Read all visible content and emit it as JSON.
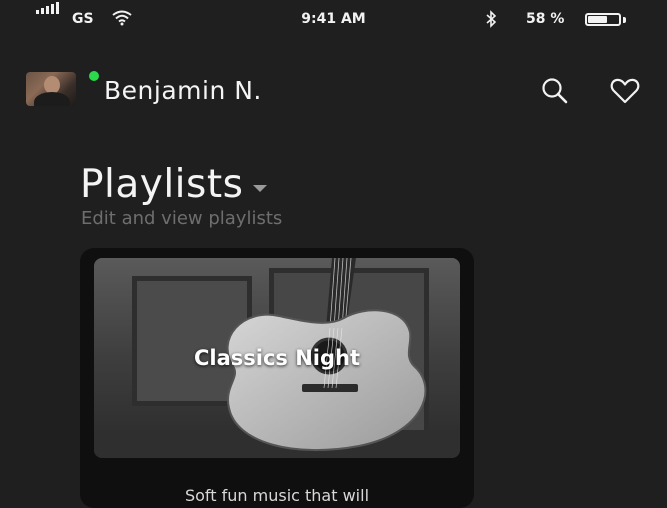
{
  "status_bar": {
    "carrier": "GS",
    "time": "9:41 AM",
    "battery_percent": "58 %",
    "battery_level": 0.58
  },
  "header": {
    "user_name": "Benjamin N.",
    "online_color": "#2bd94a"
  },
  "page": {
    "title": "Playlists",
    "subtitle": "Edit and view playlists"
  },
  "playlists": [
    {
      "name": "Classics Night",
      "description": "Soft fun music that will"
    }
  ],
  "icons": {
    "signal": "signal-bars-icon",
    "wifi": "wifi-icon",
    "bluetooth": "bluetooth-icon",
    "battery": "battery-icon",
    "search": "search-icon",
    "favorites": "heart-icon",
    "dropdown": "caret-down-icon"
  }
}
